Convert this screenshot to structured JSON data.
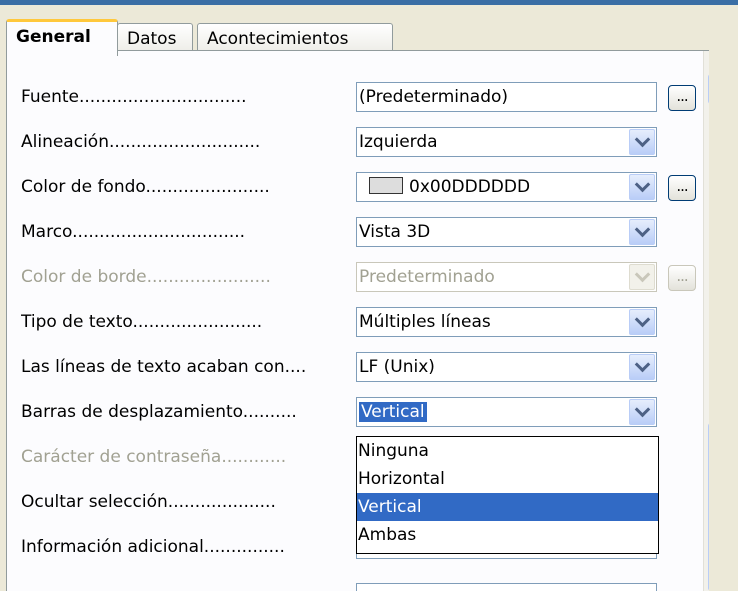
{
  "tabs": [
    {
      "label": "General"
    },
    {
      "label": "Datos"
    },
    {
      "label": "Acontecimientos"
    }
  ],
  "rows": [
    {
      "label": "Fuente...............................",
      "value": "(Predeterminado)"
    },
    {
      "label": "Alineación............................",
      "value": "Izquierda"
    },
    {
      "label": "Color de fondo.......................",
      "value": "0x00DDDDDD",
      "swatch_color": "#dddddd"
    },
    {
      "label": "Marco................................",
      "value": "Vista 3D"
    },
    {
      "label": "Color de borde.......................",
      "value": "Predeterminado"
    },
    {
      "label": "Tipo de texto........................",
      "value": "Múltiples líneas"
    },
    {
      "label": "Las líneas de texto acaban con....",
      "value": "LF (Unix)"
    },
    {
      "label": "Barras de desplazamiento..........",
      "value": "Vertical"
    },
    {
      "label": "Carácter de contraseña............",
      "value": ""
    },
    {
      "label": "Ocultar selección....................",
      "value": ""
    },
    {
      "label": "Información adicional...............",
      "value": ""
    }
  ],
  "dropdown": {
    "options": [
      "Ninguna",
      "Horizontal",
      "Vertical",
      "Ambas"
    ],
    "selected": "Vertical"
  },
  "ellipsis_label": "...",
  "colors": {
    "accent": "#316ac5",
    "tab_highlight": "#ffc83c",
    "disabled_text": "#a1a192"
  }
}
